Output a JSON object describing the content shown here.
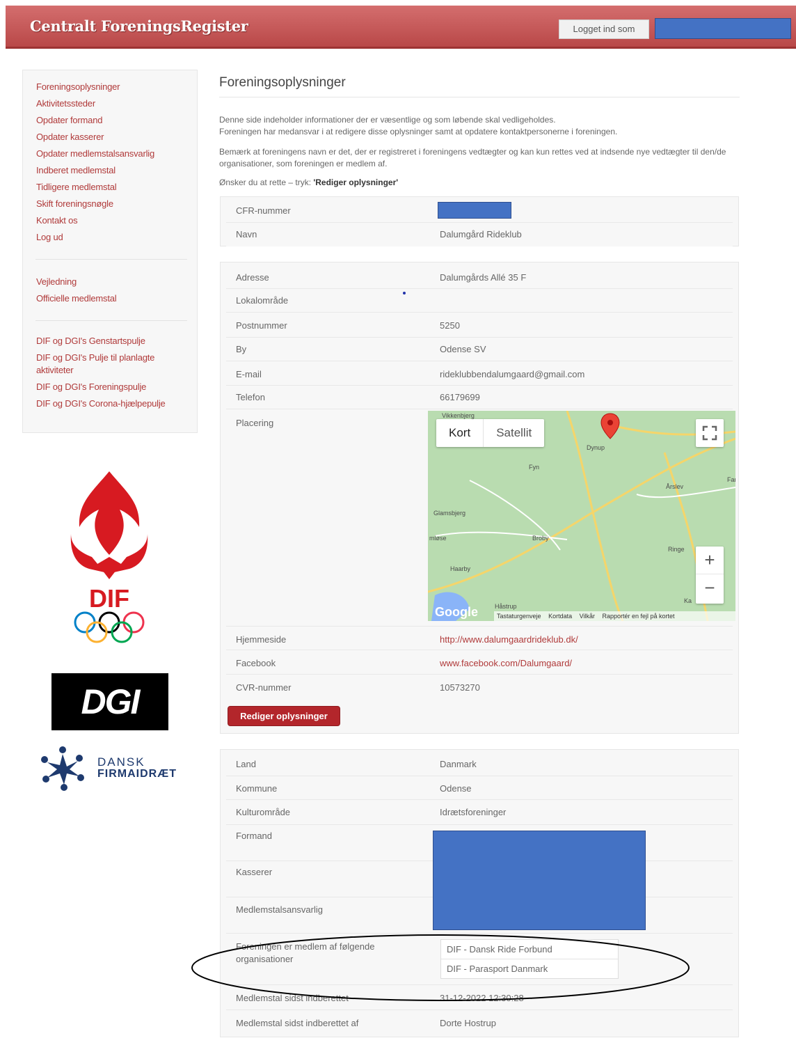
{
  "header": {
    "brand": "Centralt ForeningsRegister",
    "login_label": "Logget ind som"
  },
  "sidebar": {
    "menu_main": [
      "Foreningsoplysninger",
      "Aktivitetssteder",
      "Opdater formand",
      "Opdater kasserer",
      "Opdater medlemstalsansvarlig",
      "Indberet medlemstal",
      "Tidligere medlemstal",
      "Skift foreningsnøgle",
      "Kontakt os",
      "Log ud"
    ],
    "menu_help": [
      "Vejledning",
      "Officielle medlemstal"
    ],
    "menu_pools": [
      "DIF og DGI's Genstartspulje",
      "DIF og DGI's Pulje til planlagte aktiviteter",
      "DIF og DGI's Foreningspulje",
      "DIF og DGI's Corona-hjælpepulje"
    ]
  },
  "logos": {
    "dif": "DIF",
    "dgi": "DGI",
    "df_line1": "DANSK",
    "df_line2": "FIRMAIDRÆT"
  },
  "main": {
    "title": "Foreningsoplysninger",
    "intro1": "Denne side indeholder informationer der er væsentlige og som løbende skal vedligeholdes.",
    "intro2": "Foreningen har medansvar i at redigere disse oplysninger samt at opdatere kontaktpersonerne i foreningen.",
    "intro3": "Bemærk at foreningens navn er det, der er registreret i foreningens vedtægter og kan kun rettes ved at indsende nye vedtægter til den/de organisationer, som foreningen er medlem af.",
    "intro4_prefix": "Ønsker du at rette – tryk: ",
    "intro4_bold": "'Rediger oplysninger'",
    "panel1": {
      "cfr_label": "CFR-nummer",
      "name_label": "Navn",
      "name_value": "Dalumgård Rideklub"
    },
    "panel2": {
      "address_label": "Adresse",
      "address_value": "Dalumgårds Allé 35 F",
      "local_label": "Lokalområde",
      "zip_label": "Postnummer",
      "zip_value": "5250",
      "city_label": "By",
      "city_value": "Odense SV",
      "email_label": "E-mail",
      "email_value": "rideklubbendalumgaard@gmail.com",
      "phone_label": "Telefon",
      "phone_value": "66179699",
      "location_label": "Placering",
      "website_label": "Hjemmeside",
      "website_value": "http://www.dalumgaardrideklub.dk/",
      "facebook_label": "Facebook",
      "facebook_value": "www.facebook.com/Dalumgaard/",
      "cvr_label": "CVR-nummer",
      "cvr_value": "10573270",
      "edit_button": "Rediger oplysninger"
    },
    "map": {
      "tab_map": "Kort",
      "tab_satellite": "Satellit",
      "zoom_in": "+",
      "zoom_out": "−",
      "google": "Google",
      "footer": [
        "Tastaturgenveje",
        "Kortdata",
        "Vilkår",
        "Rapportér en fejl på kortet"
      ],
      "towns": [
        "Vikkenbjerg",
        "Dynup",
        "Fyn",
        "Årslev",
        "Glamsbjerg",
        "Broby",
        "Ringe",
        "Haarby",
        "Håstrup",
        "Fam",
        "mløse",
        "Ka"
      ]
    },
    "panel3": {
      "country_label": "Land",
      "country_value": "Danmark",
      "municipality_label": "Kommune",
      "municipality_value": "Odense",
      "culture_label": "Kulturområde",
      "culture_value": "Idrætsforeninger",
      "chairman_label": "Formand",
      "treasurer_label": "Kasserer",
      "members_resp_label": "Medlemstalsansvarlig",
      "orgs_label": "Foreningen er medlem af følgende organisationer",
      "orgs": [
        "DIF - Dansk Ride Forbund",
        "DIF - Parasport Danmark"
      ],
      "last_reported_label": "Medlemstal sidst indberettet",
      "last_reported_value": "31-12-2022 12:30:28",
      "last_reported_by_label": "Medlemstal sidst indberettet af",
      "last_reported_by_value": "Dorte Hostrup"
    }
  },
  "colors": {
    "header": "#c45a5a",
    "accent": "#b03a3a",
    "redaction": "#4472c4"
  }
}
